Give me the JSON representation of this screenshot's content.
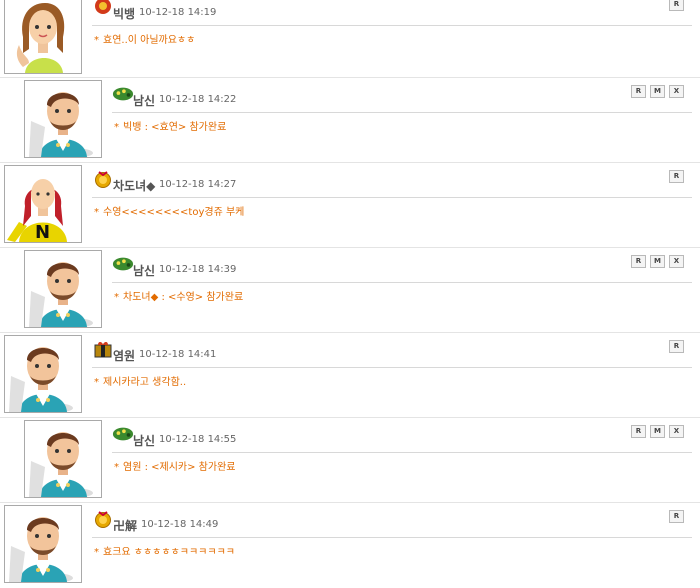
{
  "comments": [
    {
      "name": "빅뱅",
      "date": "10-12-18 14:19",
      "text": "효연..이 아닐까요ㅎㅎ",
      "reply": false,
      "badge": "red-flower-icon",
      "avatar": "girl-avatar",
      "buttons": [
        "R"
      ]
    },
    {
      "name": "남신",
      "date": "10-12-18 14:22",
      "text": "빅뱅 : <효연> 참가완료",
      "reply": true,
      "badge": "green-dragon-icon",
      "avatar": "boy-avatar",
      "buttons": [
        "R",
        "M",
        "X"
      ]
    },
    {
      "name": "차도녀◆",
      "date": "10-12-18 14:27",
      "text": "수영<<<<<<<<toy경쥬 부케",
      "reply": false,
      "badge": "gold-medal-icon",
      "avatar": "red-hair-avatar",
      "buttons": [
        "R"
      ]
    },
    {
      "name": "남신",
      "date": "10-12-18 14:39",
      "text": "차도녀◆ : <수영> 참가완료",
      "reply": true,
      "badge": "green-dragon-icon",
      "avatar": "boy-avatar",
      "buttons": [
        "R",
        "M",
        "X"
      ]
    },
    {
      "name": "염원",
      "date": "10-12-18 14:41",
      "text": "제시카라고 생각함..",
      "reply": false,
      "badge": "gift-box-icon",
      "avatar": "boy-avatar",
      "buttons": [
        "R"
      ]
    },
    {
      "name": "남신",
      "date": "10-12-18 14:55",
      "text": "염원 : <제시카> 참가완료",
      "reply": true,
      "badge": "green-dragon-icon",
      "avatar": "boy-avatar",
      "buttons": [
        "R",
        "M",
        "X"
      ]
    },
    {
      "name": "卍解",
      "date": "10-12-18 14:49",
      "text": "효크요 ㅎㅎㅎㅎㅎㅋㅋㅋㅋㅋㅋ",
      "reply": false,
      "badge": "gold-medal-icon",
      "avatar": "boy-avatar",
      "buttons": [
        "R"
      ]
    }
  ],
  "star": "*",
  "colors": {
    "accent": "#e26b00",
    "name": "#555555",
    "border": "#a9a9a9"
  }
}
